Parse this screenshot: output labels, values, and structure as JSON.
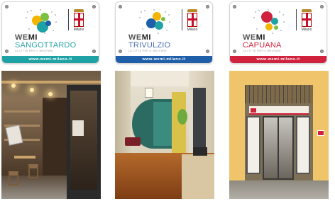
{
  "cards": [
    {
      "brand_we": "WE",
      "brand_mi": "MI",
      "location": "SANGOTTARDO",
      "tagline": "LA CITTÀ PER IL WELFARE",
      "city": "Milano",
      "url": "www.wemi.milano.it",
      "accent_color": "#1fa2a6"
    },
    {
      "brand_we": "WE",
      "brand_mi": "MI",
      "location": "TRIVULZIO",
      "tagline": "LA CITTÀ PER IL WELFARE",
      "city": "Milano",
      "url": "www.wemi.milano.it",
      "accent_color": "#1f5fa9"
    },
    {
      "brand_we": "WE",
      "brand_mi": "MI",
      "location": "CAPUANA",
      "tagline": "LA CITTÀ PER IL WELFARE",
      "city": "Milano",
      "url": "www.wemi.milano.it",
      "accent_color": "#d0223d"
    }
  ]
}
